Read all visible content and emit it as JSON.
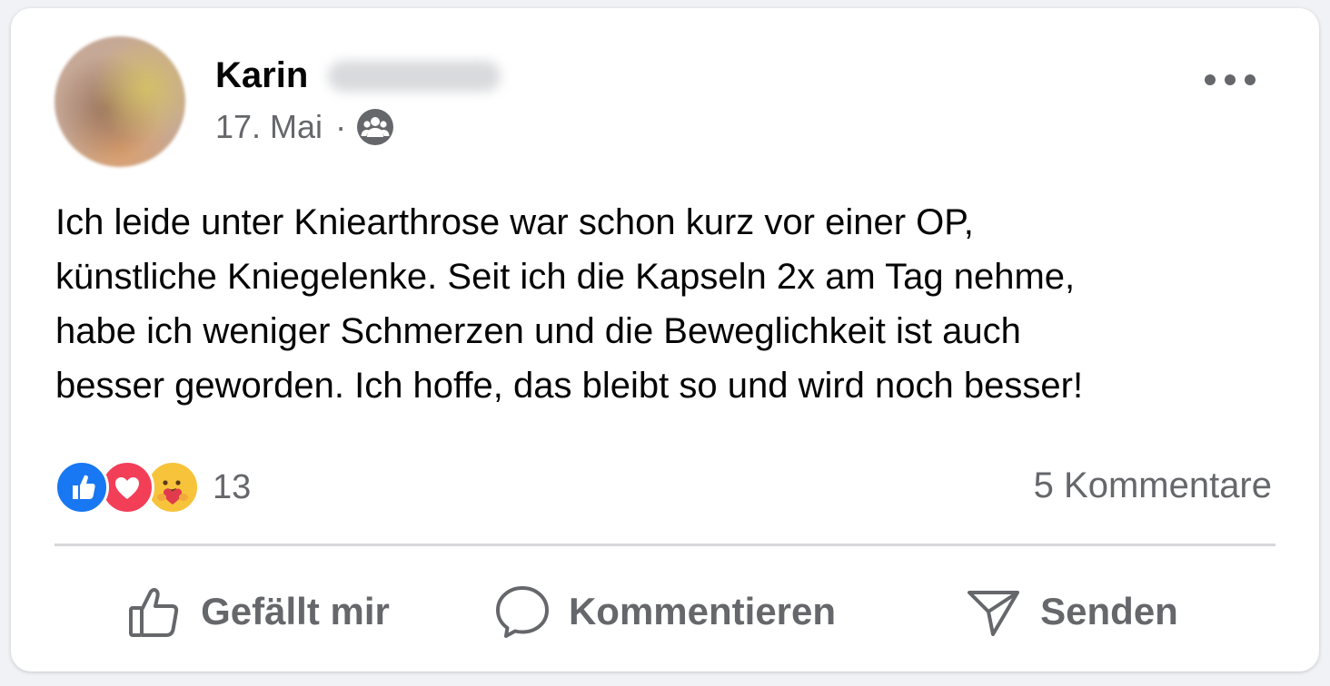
{
  "post": {
    "author_name": "Karin",
    "date": "17. Mai",
    "separator": "·",
    "audience_icon": "friends-icon",
    "text": "Ich leide unter Kniearthrose war schon kurz vor einer OP,\nkünstliche Kniegelenke. Seit ich die Kapseln 2x am Tag nehme,\nhabe ich weniger Schmerzen und die Beweglichkeit ist auch\nbesser geworden. Ich hoffe, das bleibt so und wird noch besser!"
  },
  "reactions": {
    "types": [
      "like-icon",
      "love-icon",
      "care-icon"
    ],
    "count": "13"
  },
  "comments": {
    "count_label": "5 Kommentare"
  },
  "actions": {
    "like_label": "Gefällt mir",
    "comment_label": "Kommentieren",
    "send_label": "Senden"
  },
  "colors": {
    "like_blue": "#1877f2",
    "love_red": "#f33e58",
    "care_yellow": "#f7c33b",
    "secondary_text": "#65676b"
  }
}
